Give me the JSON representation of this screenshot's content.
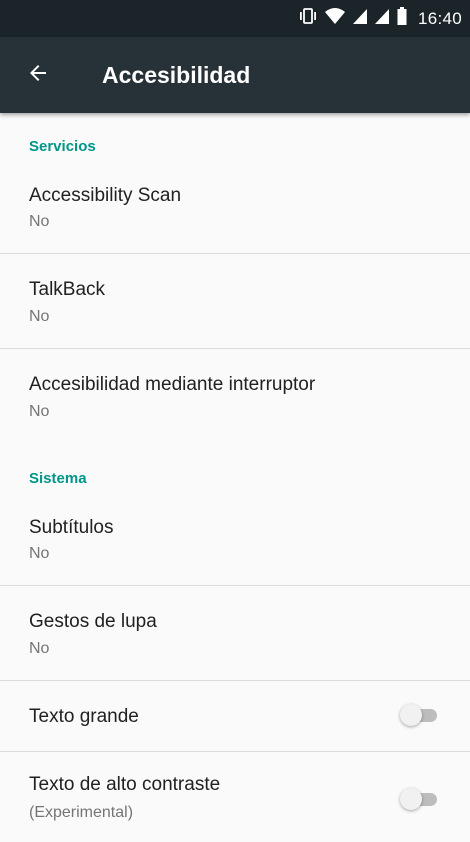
{
  "status_bar": {
    "time": "16:40",
    "icons": [
      "vibrate-icon",
      "wifi-icon",
      "signal-icon",
      "signal-icon",
      "battery-icon"
    ]
  },
  "app_bar": {
    "back_icon": "arrow-back-icon",
    "title": "Accesibilidad",
    "background": "#263238"
  },
  "sections": {
    "servicios": {
      "header": "Servicios",
      "items": [
        {
          "title": "Accessibility Scan",
          "summary": "No"
        },
        {
          "title": "TalkBack",
          "summary": "No"
        },
        {
          "title": "Accesibilidad mediante interruptor",
          "summary": "No"
        }
      ]
    },
    "sistema": {
      "header": "Sistema",
      "items": [
        {
          "title": "Subtítulos",
          "summary": "No"
        },
        {
          "title": "Gestos de lupa",
          "summary": "No"
        },
        {
          "title": "Texto grande",
          "switch_on": false
        },
        {
          "title": "Texto de alto contraste",
          "summary": "(Experimental)",
          "switch_on": false
        }
      ]
    }
  },
  "colors": {
    "accent": "#009688",
    "status_bar": "#1b2529",
    "background": "#fafafa"
  }
}
